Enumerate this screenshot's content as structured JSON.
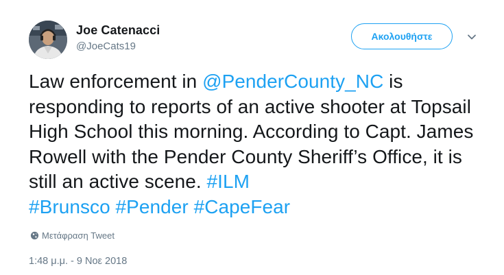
{
  "author": {
    "name": "Joe Catenacci",
    "handle": "@JoeCats19"
  },
  "follow_button": {
    "label": "Ακολουθήστε"
  },
  "tweet": {
    "segments": [
      {
        "text": "Law enforcement in ",
        "link": false
      },
      {
        "text": "@PenderCounty_NC",
        "link": true
      },
      {
        "text": " is responding to reports of an active shooter at Topsail High School this morning. According to Capt. James Rowell with the Pender County Sheriff’s Office, it is still an active scene. ",
        "link": false
      },
      {
        "text": "#ILM",
        "link": true
      },
      {
        "text": " ",
        "link": false
      },
      {
        "text": "#Brunsco",
        "link": true
      },
      {
        "text": " ",
        "link": false
      },
      {
        "text": "#Pender",
        "link": true
      },
      {
        "text": " ",
        "link": false
      },
      {
        "text": "#CapeFear",
        "link": true
      }
    ],
    "translate_label": "Μετάφραση Tweet",
    "timestamp": "1:48 μ.μ. - 9 Νοε 2018"
  },
  "colors": {
    "link": "#1da1f2",
    "text": "#14171a",
    "secondary": "#657786"
  },
  "icons": [
    "avatar-photo",
    "globe-icon",
    "chevron-down-icon"
  ]
}
